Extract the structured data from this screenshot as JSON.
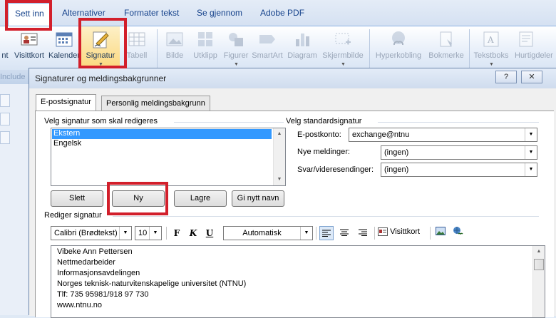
{
  "ribbon": {
    "tabs": [
      {
        "label": "Sett inn",
        "active": true
      },
      {
        "label": "Alternativer"
      },
      {
        "label": "Formater tekst"
      },
      {
        "label": "Se gjennom"
      },
      {
        "label": "Adobe PDF"
      }
    ],
    "buttons": [
      {
        "label": "nt",
        "icon": "attach-icon"
      },
      {
        "label": "Visittkort",
        "icon": "business-card-icon"
      },
      {
        "label": "Kalender",
        "icon": "calendar-icon"
      },
      {
        "label": "Signatur",
        "icon": "signature-pen-icon"
      },
      {
        "label": "Tabell",
        "icon": "table-icon"
      },
      {
        "label": "Bilde",
        "icon": "picture-icon"
      },
      {
        "label": "Utklipp",
        "icon": "clipart-icon"
      },
      {
        "label": "Figurer",
        "icon": "shapes-icon"
      },
      {
        "label": "SmartArt",
        "icon": "smartart-icon"
      },
      {
        "label": "Diagram",
        "icon": "chart-icon"
      },
      {
        "label": "Skjermbilde",
        "icon": "screenshot-icon"
      },
      {
        "label": "Hyperkobling",
        "icon": "hyperlink-icon"
      },
      {
        "label": "Bokmerke",
        "icon": "bookmark-icon"
      },
      {
        "label": "Tekstboks",
        "icon": "textbox-icon"
      },
      {
        "label": "Hurtigdeler",
        "icon": "quickparts-icon"
      }
    ],
    "groups": {
      "left_fragment": "Include"
    }
  },
  "dialog": {
    "title": "Signaturer og meldingsbakgrunner",
    "help_btn": "?",
    "close_btn": "✕",
    "tabs": [
      "E-postsignatur",
      "Personlig meldingsbakgrunn"
    ],
    "select_label": "Velg signatur som skal redigeres",
    "signatures": [
      "Ekstern",
      "Engelsk"
    ],
    "selected_signature": "Ekstern",
    "buttons": {
      "delete": "Slett",
      "new": "Ny",
      "save": "Lagre",
      "rename": "Gi nytt navn"
    },
    "default_sig": {
      "label": "Velg standardsignatur",
      "account_label": "E-postkonto:",
      "account_value": "exchange@ntnu",
      "new_label": "Nye meldinger:",
      "new_value": "(ingen)",
      "reply_label": "Svar/videresendinger:",
      "reply_value": "(ingen)"
    },
    "edit_label": "Rediger signatur",
    "toolbar": {
      "font": "Calibri (Brødtekst)",
      "size": "10",
      "bold": "F",
      "italic": "K",
      "underline": "U",
      "color": "Automatisk",
      "business_card": "Visittkort"
    },
    "signature_lines": [
      "Vibeke Ann Pettersen",
      "Nettmedarbeider",
      "Informasjonsavdelingen",
      "Norges teknisk-naturvitenskapelige universitet (NTNU)",
      "Tlf: 735 95981/918 97 730",
      "www.ntnu.no"
    ]
  },
  "colors": {
    "highlight": "#d21f2b",
    "selection": "#3399ff",
    "accent": "#15428b"
  }
}
